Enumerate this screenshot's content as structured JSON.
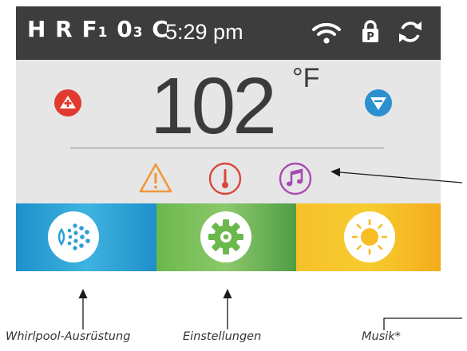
{
  "status": {
    "code_letters": "H R F",
    "code_sub1": "1",
    "code_zero": "0",
    "code_sub2": "3",
    "code_last": "C",
    "time": "5:29 pm",
    "icons": [
      "wifi-icon",
      "lock-icon",
      "sync-icon"
    ]
  },
  "temperature": {
    "value": "102",
    "unit": "°F"
  },
  "indicators": [
    "warning-icon",
    "thermometer-icon",
    "music-icon"
  ],
  "tiles": [
    {
      "name": "jets",
      "icon": "jets-icon"
    },
    {
      "name": "settings",
      "icon": "gear-icon"
    },
    {
      "name": "light",
      "icon": "sun-icon"
    }
  ],
  "captions": {
    "jets": "Whirlpool-Ausrüstung",
    "settings": "Einstellungen",
    "music": "Musik*"
  },
  "colors": {
    "statusbar": "#3d3d3d",
    "screen_bg": "#e6e6e7",
    "up_button": "#e13a2f",
    "down_button": "#2b8fd0",
    "warning": "#f0983a",
    "thermometer": "#d9473a",
    "music": "#a84bb0",
    "jets_tile": "#2ba0d6",
    "settings_tile": "#7cbd5a",
    "light_tile": "#f6bd24"
  }
}
